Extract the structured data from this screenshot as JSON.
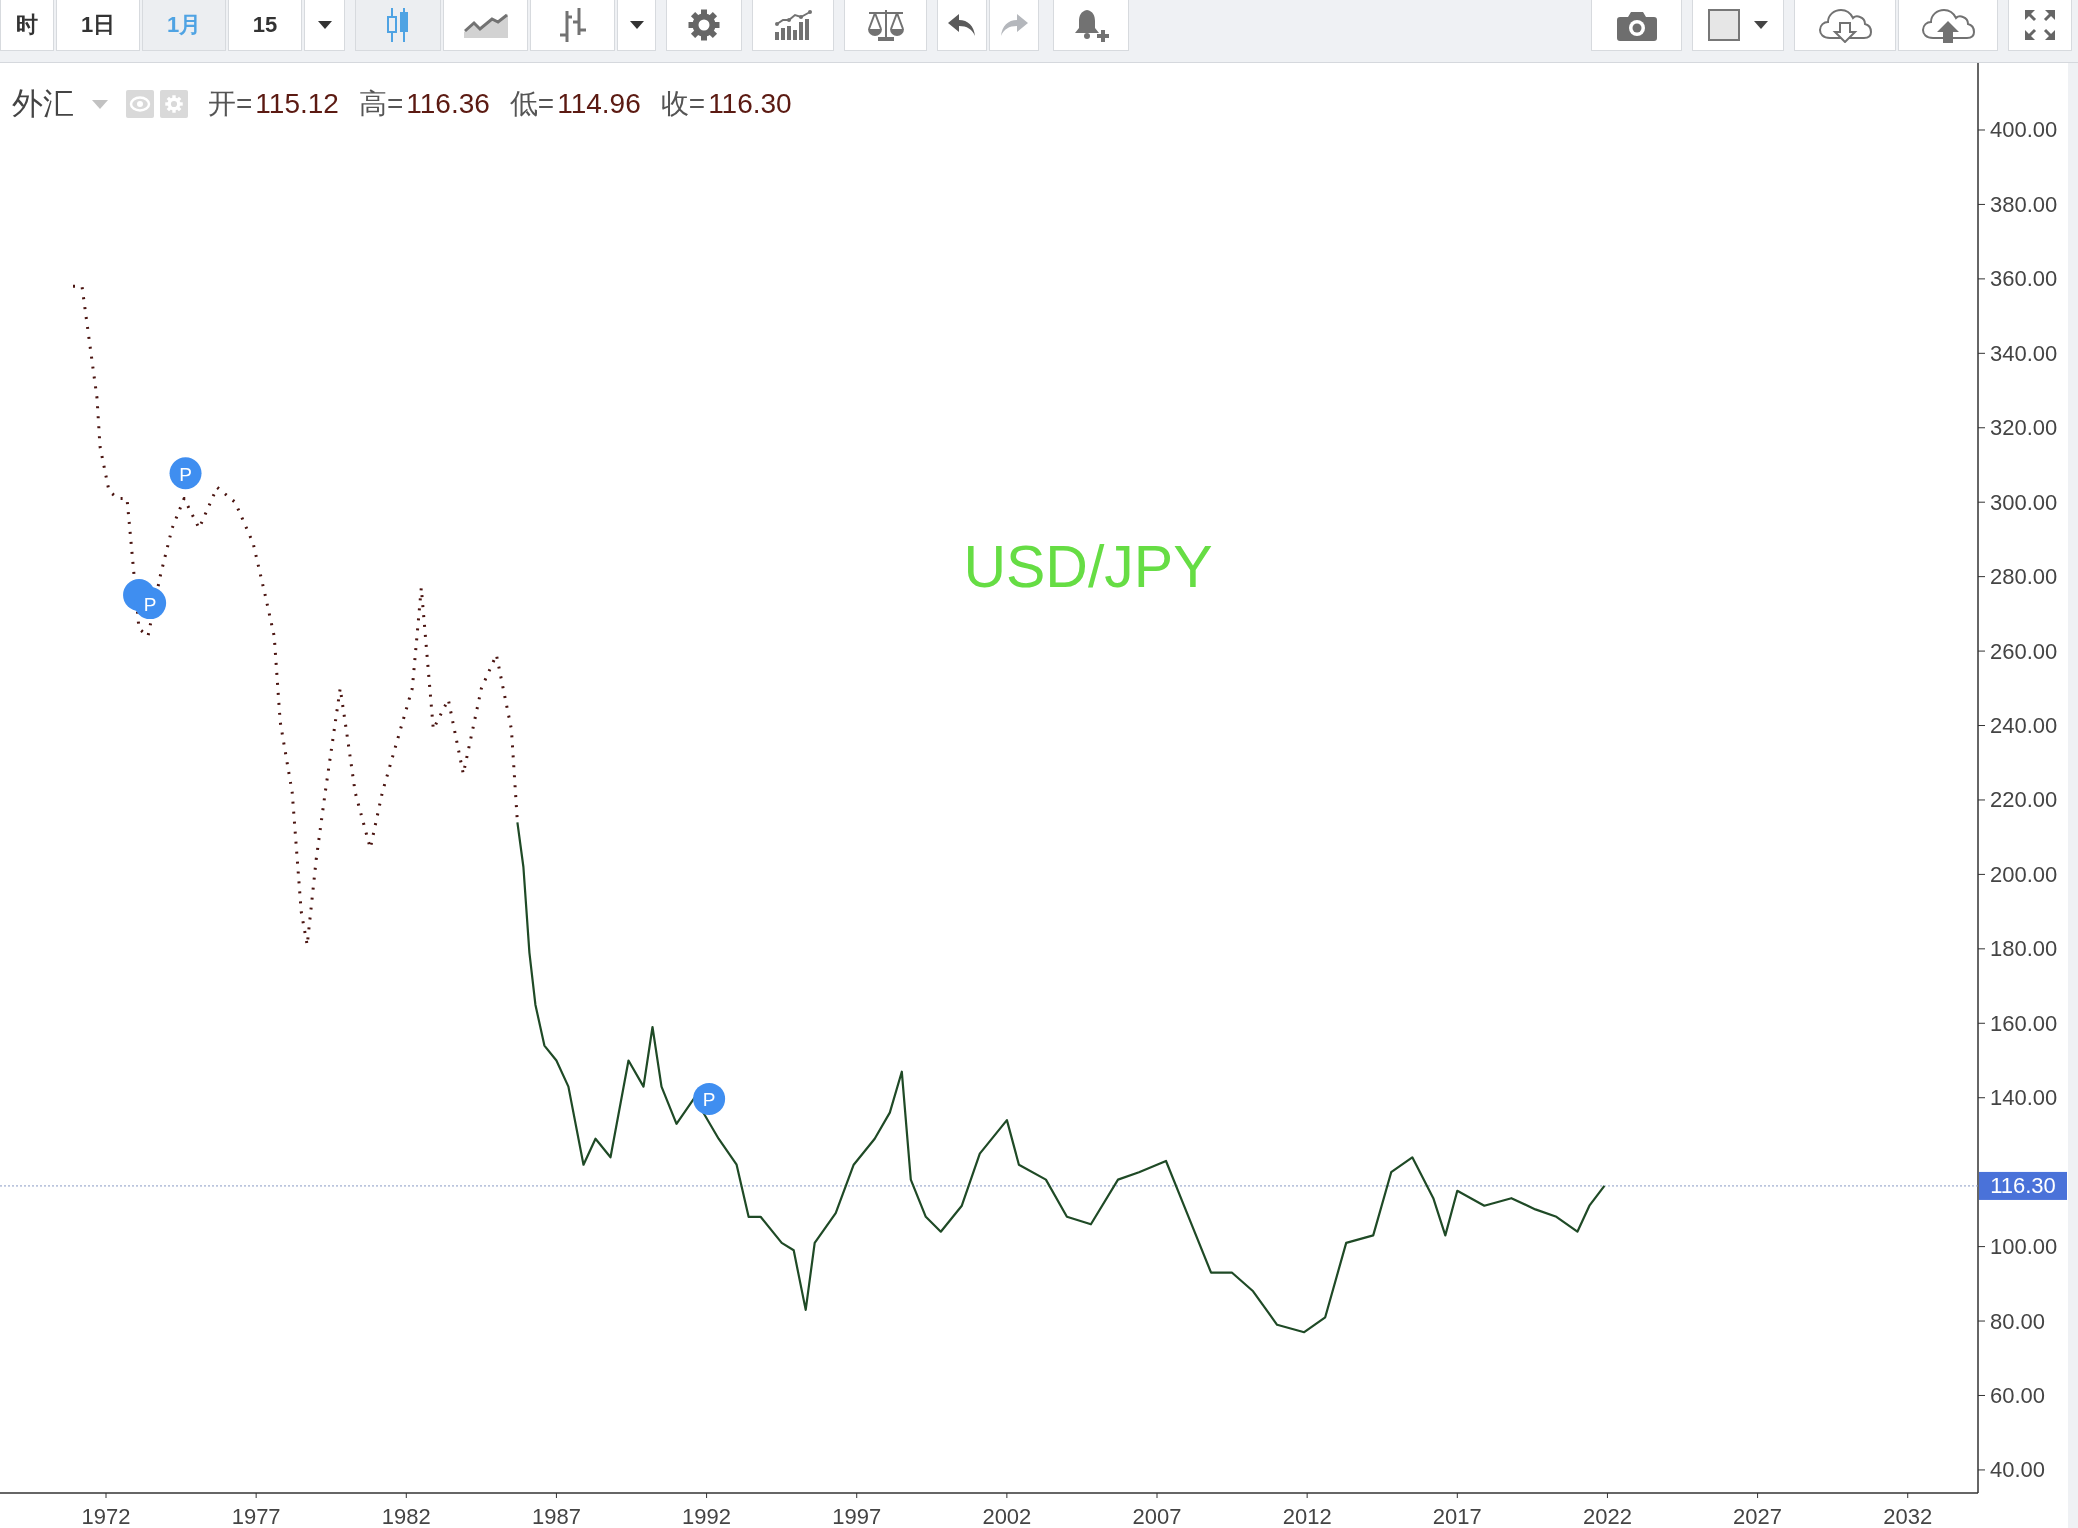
{
  "toolbar": {
    "intervals": [
      {
        "label": "时",
        "selected": false
      },
      {
        "label": "1日",
        "selected": false
      },
      {
        "label": "1月",
        "selected": true
      },
      {
        "label": "15",
        "selected": false
      }
    ],
    "chart_types": [
      {
        "kind": "candlestick",
        "selected": true
      },
      {
        "kind": "area",
        "selected": false
      },
      {
        "kind": "ohlc",
        "selected": false
      }
    ],
    "history": [
      {
        "kind": "undo",
        "disabled": false
      },
      {
        "kind": "redo",
        "disabled": true
      }
    ]
  },
  "legend": {
    "symbol": "外汇",
    "fields": [
      {
        "label": "开=",
        "value": "115.12"
      },
      {
        "label": "高=",
        "value": "116.36"
      },
      {
        "label": "低=",
        "value": "114.96"
      },
      {
        "label": "收=",
        "value": "116.30"
      }
    ]
  },
  "chart_data": {
    "type": "line",
    "title": "USD/JPY",
    "x": [
      1970.9,
      1971.2,
      1971.5,
      1971.7,
      1971.8,
      1972.1,
      1972.4,
      1972.7,
      1973.1,
      1973.4,
      1973.8,
      1974.2,
      1974.6,
      1975.1,
      1975.7,
      1976.3,
      1976.9,
      1977.3,
      1977.6,
      1977.8,
      1978.2,
      1978.5,
      1978.7,
      1979.0,
      1979.3,
      1979.8,
      1980.0,
      1980.3,
      1980.8,
      1981.2,
      1981.7,
      1982.2,
      1982.5,
      1982.9,
      1983.4,
      1983.9,
      1984.5,
      1985.0,
      1985.5,
      1985.7,
      1985.9,
      1986.1,
      1986.3,
      1986.6,
      1987.0,
      1987.4,
      1987.9,
      1988.3,
      1988.8,
      1989.4,
      1989.9,
      1990.2,
      1990.5,
      1991.0,
      1991.6,
      1992.4,
      1993.0,
      1993.4,
      1993.8,
      1994.5,
      1994.9,
      1995.3,
      1995.6,
      1996.3,
      1996.9,
      1997.6,
      1998.1,
      1998.5,
      1998.8,
      1999.3,
      1999.8,
      2000.5,
      2001.1,
      2002.0,
      2002.4,
      2003.3,
      2004.0,
      2004.8,
      2005.7,
      2006.4,
      2007.3,
      2007.9,
      2008.8,
      2009.5,
      2010.2,
      2011.0,
      2011.9,
      2012.6,
      2013.3,
      2014.2,
      2014.8,
      2015.5,
      2016.2,
      2016.6,
      2017.0,
      2017.9,
      2018.8,
      2019.6,
      2020.3,
      2021.0,
      2021.4,
      2021.9
    ],
    "series": [
      {
        "line_style": "dotted",
        "color": "#4a1410",
        "values": [
          358,
          358,
          340,
          328,
          315,
          303,
          301,
          301,
          266,
          264,
          280,
          293,
          301,
          293,
          304,
          300,
          289,
          275,
          264,
          241,
          222,
          190,
          181,
          204,
          222,
          250,
          239,
          222,
          207,
          222,
          236,
          250,
          277,
          239,
          247,
          227,
          250,
          259,
          239,
          214,
          null,
          null,
          null,
          null,
          null,
          null,
          null,
          null,
          null,
          null,
          null,
          null,
          null,
          null,
          null,
          null,
          null,
          null,
          null,
          null,
          null,
          null,
          null,
          null,
          null,
          null,
          null,
          null,
          null,
          null,
          null,
          null,
          null,
          null,
          null,
          null,
          null,
          null,
          null,
          null,
          null,
          null,
          null,
          null,
          null,
          null,
          null,
          null,
          null,
          null,
          null,
          null,
          null,
          null,
          null,
          null,
          null,
          null,
          null,
          null,
          null,
          null
        ]
      },
      {
        "line_style": "solid",
        "color": "#1f4a26",
        "values": [
          null,
          null,
          null,
          null,
          null,
          null,
          null,
          null,
          null,
          null,
          null,
          null,
          null,
          null,
          null,
          null,
          null,
          null,
          null,
          null,
          null,
          null,
          null,
          null,
          null,
          null,
          null,
          null,
          null,
          null,
          null,
          null,
          null,
          null,
          null,
          null,
          null,
          null,
          null,
          214,
          202,
          179,
          165,
          154,
          150,
          143,
          122,
          129,
          124,
          150,
          143,
          159,
          143,
          133,
          140,
          129,
          122,
          108,
          108,
          101,
          99,
          83,
          101,
          109,
          122,
          129,
          136,
          147,
          118,
          108,
          104,
          111,
          125,
          134,
          122,
          118,
          108,
          106,
          118,
          120,
          123,
          111,
          93,
          93,
          88,
          79,
          77,
          81,
          101,
          103,
          120,
          124,
          113,
          103,
          115,
          111,
          113,
          110,
          108,
          104,
          111,
          116.3
        ]
      }
    ],
    "xlim": [
      1968.47,
      2034.34
    ],
    "ylim": [
      33.8,
      418
    ],
    "xticks": [
      1972,
      1977,
      1982,
      1987,
      1992,
      1997,
      2002,
      2007,
      2012,
      2017,
      2022,
      2027,
      2032
    ],
    "yticks": [
      {
        "value": 400,
        "label": "400.00"
      },
      {
        "value": 380,
        "label": "380.00"
      },
      {
        "value": 360,
        "label": "360.00"
      },
      {
        "value": 340,
        "label": "340.00"
      },
      {
        "value": 320,
        "label": "320.00"
      },
      {
        "value": 300,
        "label": "300.00"
      },
      {
        "value": 280,
        "label": "280.00"
      },
      {
        "value": 260,
        "label": "260.00"
      },
      {
        "value": 240,
        "label": "240.00"
      },
      {
        "value": 220,
        "label": "220.00"
      },
      {
        "value": 200,
        "label": "200.00"
      },
      {
        "value": 180,
        "label": "180.00"
      },
      {
        "value": 160,
        "label": "160.00"
      },
      {
        "value": 140,
        "label": "140.00"
      },
      {
        "value": 100,
        "label": "100.00"
      },
      {
        "value": 80,
        "label": "80.00"
      },
      {
        "value": 60,
        "label": "60.00"
      },
      {
        "value": 40,
        "label": "40.00"
      }
    ],
    "ref_lines": [
      {
        "axis": "y",
        "value": 116.3,
        "label": "116.30"
      }
    ],
    "annotations": [
      "P",
      "P",
      "P"
    ]
  }
}
